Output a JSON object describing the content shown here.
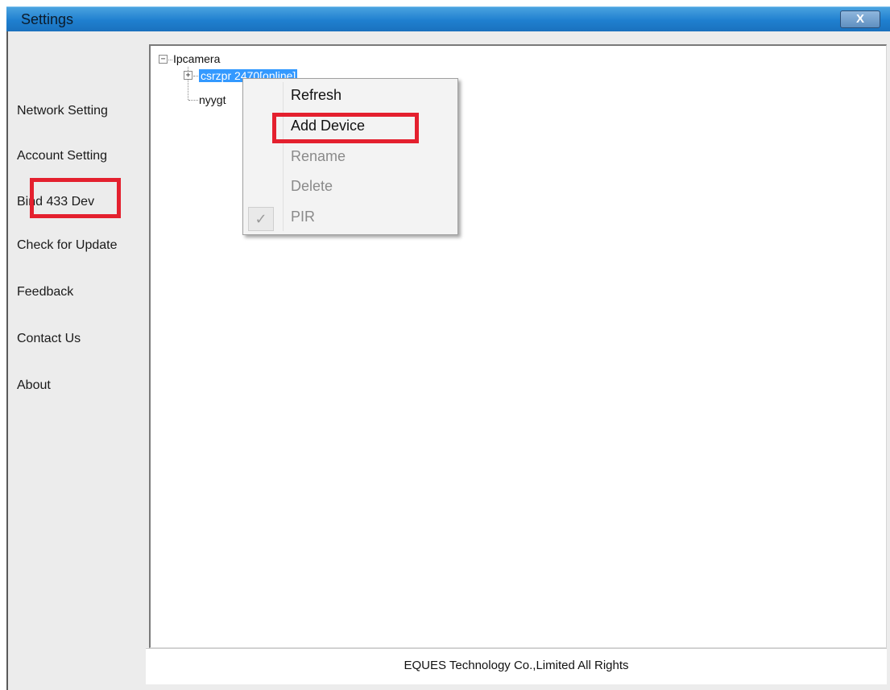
{
  "window": {
    "title": "Settings",
    "close_label": "X"
  },
  "sidebar": {
    "items": [
      {
        "label": "Network Setting"
      },
      {
        "label": "Account Setting"
      },
      {
        "label": "Bind 433 Dev"
      },
      {
        "label": "Check for Update"
      },
      {
        "label": "Feedback"
      },
      {
        "label": "Contact Us"
      },
      {
        "label": "About"
      }
    ]
  },
  "tree": {
    "root": {
      "label": "Ipcamera",
      "expander": "−"
    },
    "children": [
      {
        "label": "csrzpr  2470[online]",
        "expander": "+",
        "selected": true
      },
      {
        "label": "nyygt"
      }
    ]
  },
  "context_menu": {
    "items": [
      {
        "label": "Refresh",
        "enabled": true
      },
      {
        "label": "Add Device",
        "enabled": true
      },
      {
        "label": "Rename",
        "enabled": false
      },
      {
        "label": "Delete",
        "enabled": false
      },
      {
        "label": "PIR",
        "enabled": false,
        "checked": true
      }
    ],
    "check_glyph": "✓"
  },
  "footer": {
    "text": "EQUES Technology Co.,Limited All Rights"
  },
  "colors": {
    "highlight": "#e4202e",
    "selection": "#3399ff",
    "titlebar": "#1f7fcf"
  }
}
